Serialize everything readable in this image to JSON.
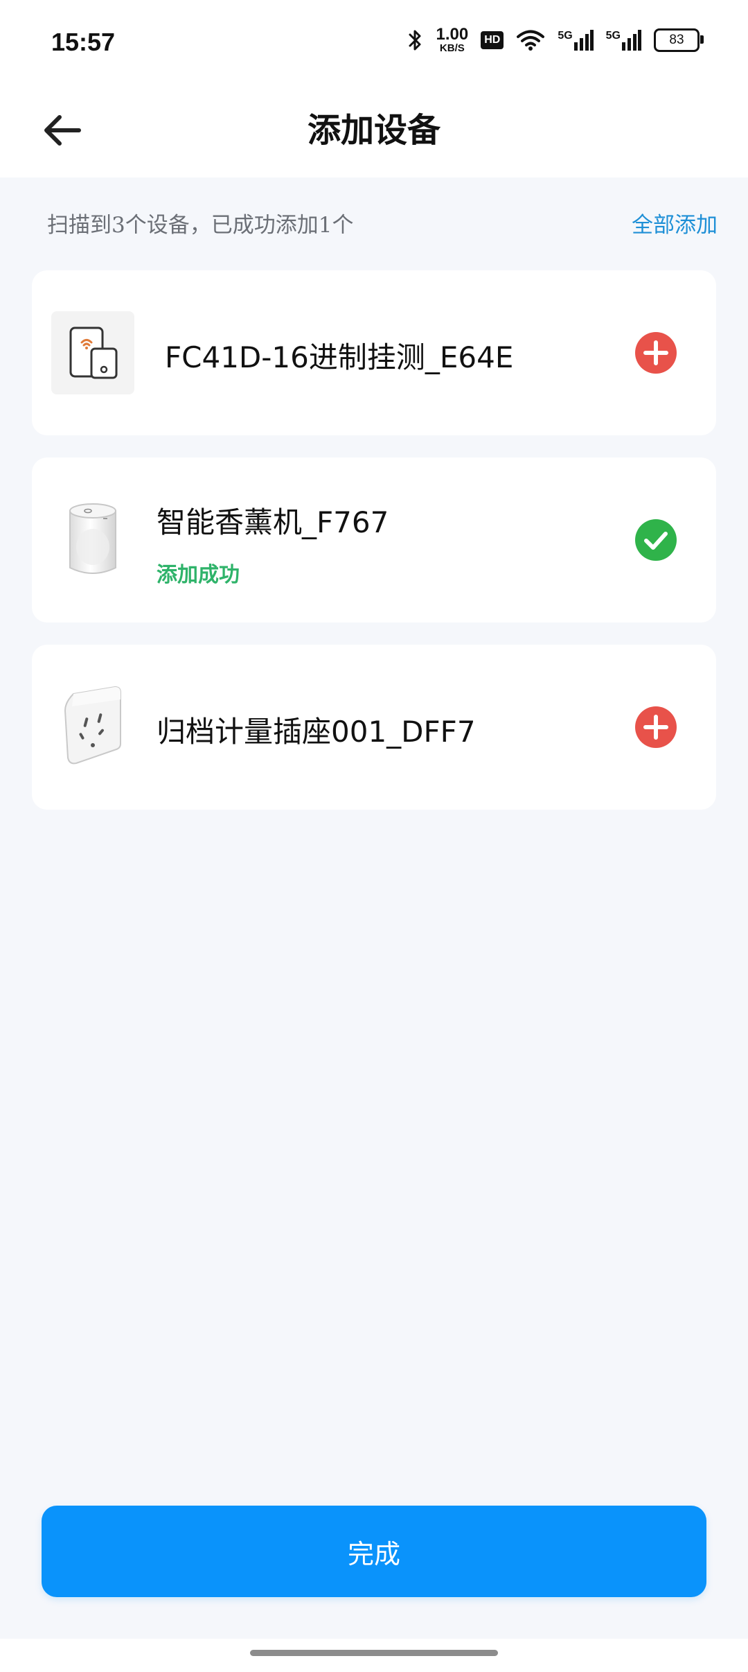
{
  "status_bar": {
    "time": "15:57",
    "net_speed_value": "1.00",
    "net_speed_unit": "KB/S",
    "hd_label": "HD",
    "signal_1": "5G",
    "signal_2": "5G",
    "battery": "83",
    "icons": [
      "bluetooth-icon",
      "hd-voice-icon",
      "wifi-icon",
      "signal-5g-icon",
      "signal-5g-icon",
      "battery-icon"
    ]
  },
  "header": {
    "title": "添加设备",
    "back_icon": "arrow-left-icon"
  },
  "summary": {
    "text": "扫描到3个设备，已成功添加1个",
    "add_all_label": "全部添加"
  },
  "devices": [
    {
      "name": "FC41D-16进制挂测_E64E",
      "status": "",
      "action": "add-icon",
      "thumbnail": "phone-tablet-icon"
    },
    {
      "name": "智能香薰机_F767",
      "status": "添加成功",
      "action": "check-icon",
      "thumbnail": "aroma-diffuser-image"
    },
    {
      "name": "归档计量插座001_DFF7",
      "status": "",
      "action": "add-icon",
      "thumbnail": "smart-plug-image"
    }
  ],
  "colors": {
    "primary": "#0a93fb",
    "link": "#1e8fd6",
    "success": "#2fb36a",
    "add": "#e8524a",
    "background": "#f5f7fb"
  },
  "done_button": {
    "label": "完成"
  }
}
